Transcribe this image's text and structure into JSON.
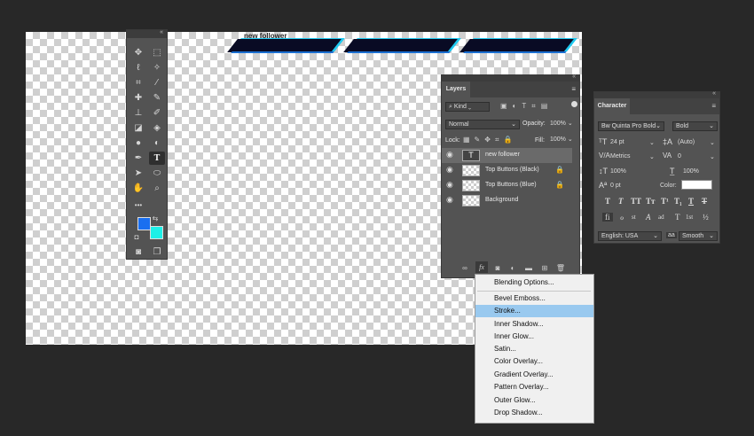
{
  "canvas": {
    "shape_text": "new follower"
  },
  "tools": {
    "icons": [
      "move-tool",
      "marquee-tool",
      "lasso-tool",
      "magic-wand-tool",
      "crop-tool",
      "eyedropper-tool",
      "healing-brush-tool",
      "brush-tool",
      "clone-stamp-tool",
      "history-brush-tool",
      "eraser-tool",
      "paint-bucket-tool",
      "blur-tool",
      "dodge-tool",
      "pen-tool",
      "type-tool",
      "path-selection-tool",
      "ellipse-tool",
      "hand-tool",
      "zoom-tool",
      "more-tools",
      "quick-mask",
      "screen-mode"
    ],
    "more_label": "•••",
    "foreground": "#1a6ff0",
    "background": "#1ef0e8"
  },
  "layers": {
    "tab_label": "Layers",
    "filter_label": "Kind",
    "blend_mode": "Normal",
    "opacity_label": "Opacity:",
    "opacity_value": "100%",
    "lock_label": "Lock:",
    "fill_label": "Fill:",
    "fill_value": "100%",
    "rows": [
      {
        "name": "new follower",
        "type": "text"
      },
      {
        "name": "Top Buttons (Black)",
        "type": "image"
      },
      {
        "name": "Top Buttons (Blue)",
        "type": "image"
      },
      {
        "name": "Background",
        "type": "image"
      }
    ],
    "fx_label": "fx"
  },
  "character": {
    "tab_label": "Character",
    "font_family": "Bw Quinta Pro Bold",
    "font_style": "Bold",
    "font_size": "24 pt",
    "leading": "(Auto)",
    "kerning": "Metrics",
    "tracking": "0",
    "vscale": "100%",
    "hscale": "100%",
    "baseline": "0 pt",
    "color_label": "Color:",
    "color_value": "#ffffff",
    "style_buttons": [
      "T",
      "T",
      "TT",
      "Tт",
      "T¹",
      "T₁",
      "T",
      "T"
    ],
    "ot_buttons": [
      "fi",
      "ℴ",
      "st",
      "A",
      "ad",
      "T",
      "1st",
      "½"
    ],
    "language": "English: USA",
    "aa_icon": "aa",
    "antialias": "Smooth"
  },
  "menu": {
    "items": [
      "Blending Options...",
      "Bevel  Emboss...",
      "Stroke...",
      "Inner Shadow...",
      "Inner Glow...",
      "Satin...",
      "Color Overlay...",
      "Gradient Overlay...",
      "Pattern Overlay...",
      "Outer Glow...",
      "Drop Shadow..."
    ],
    "highlighted_index": 2
  }
}
